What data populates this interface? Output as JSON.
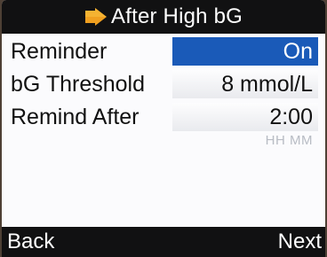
{
  "header": {
    "title": "After High bG",
    "icon": "arrow-right-icon"
  },
  "settings": [
    {
      "label": "Reminder",
      "value": "On",
      "selected": true
    },
    {
      "label": "bG Threshold",
      "value": "8 mmol/L",
      "selected": false
    },
    {
      "label": "Remind After",
      "value": "2:00",
      "selected": false
    }
  ],
  "remind_after_hint": "HH MM",
  "softkeys": {
    "left": "Back",
    "right": "Next"
  },
  "colors": {
    "selection": "#1a5ab8",
    "bars": "#111112",
    "icon": "#f0a020"
  }
}
